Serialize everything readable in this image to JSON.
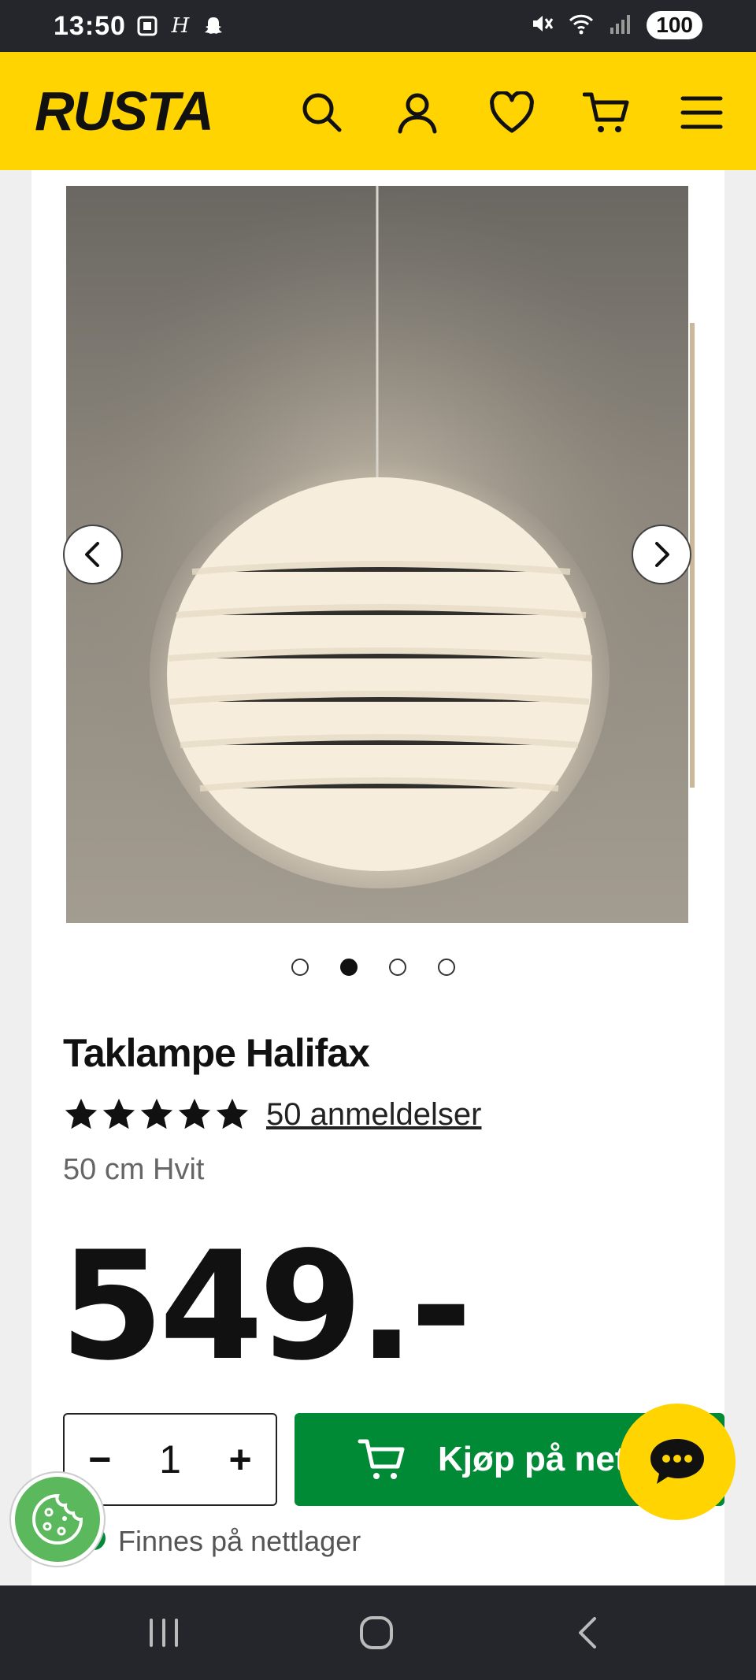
{
  "status_bar": {
    "time": "13:50",
    "battery": "100"
  },
  "header": {
    "logo_text": "RUSTA",
    "icons": [
      "search-icon",
      "user-icon",
      "heart-icon",
      "cart-icon",
      "menu-icon"
    ]
  },
  "gallery": {
    "image_alt": "Taklampe Halifax product photo",
    "slides": 4,
    "active_slide": 2
  },
  "product": {
    "title": "Taklampe Halifax",
    "stars": 5,
    "reviews": "50 anmeldelser",
    "variant": "50 cm Hvit",
    "price": "549.-"
  },
  "purchase": {
    "minus": "−",
    "quantity": "1",
    "plus": "+",
    "buy_label": "Kjøp på nett",
    "stock_text": "Finnes på nettlager"
  },
  "colors": {
    "brand_yellow": "#ffd400",
    "buy_green": "#008a36"
  }
}
